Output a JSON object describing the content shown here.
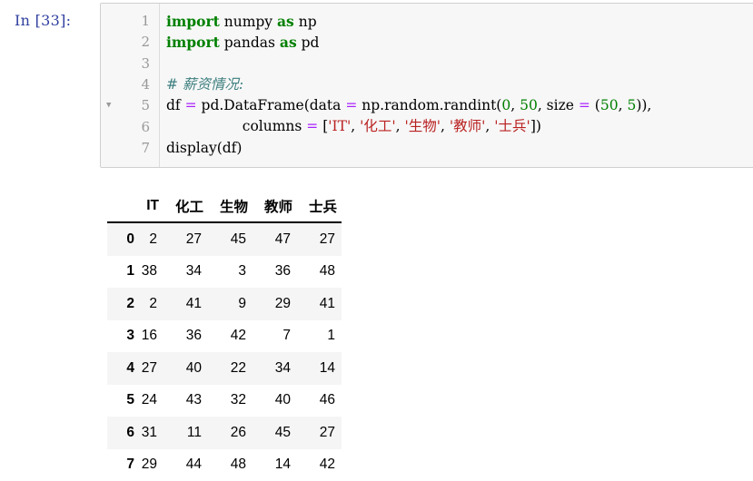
{
  "prompt": "In  [33]:",
  "code": {
    "line_numbers": [
      "1",
      "2",
      "3",
      "4",
      "5",
      "6",
      "7"
    ],
    "fold_marker_line": 5,
    "lines": [
      [
        {
          "t": "import",
          "c": "kw"
        },
        {
          "t": " numpy ",
          "c": ""
        },
        {
          "t": "as",
          "c": "kw"
        },
        {
          "t": " np",
          "c": ""
        }
      ],
      [
        {
          "t": "import",
          "c": "kw"
        },
        {
          "t": " pandas ",
          "c": ""
        },
        {
          "t": "as",
          "c": "kw"
        },
        {
          "t": " pd",
          "c": ""
        }
      ],
      [],
      [
        {
          "t": "# 薪资情况:",
          "c": "cm"
        }
      ],
      [
        {
          "t": "df ",
          "c": ""
        },
        {
          "t": "=",
          "c": "op"
        },
        {
          "t": " pd.DataFrame(data ",
          "c": ""
        },
        {
          "t": "=",
          "c": "op"
        },
        {
          "t": " np.random.randint(",
          "c": ""
        },
        {
          "t": "0",
          "c": "num"
        },
        {
          "t": ", ",
          "c": ""
        },
        {
          "t": "50",
          "c": "num"
        },
        {
          "t": ", size ",
          "c": ""
        },
        {
          "t": "=",
          "c": "op"
        },
        {
          "t": " (",
          "c": ""
        },
        {
          "t": "50",
          "c": "num"
        },
        {
          "t": ", ",
          "c": ""
        },
        {
          "t": "5",
          "c": "num"
        },
        {
          "t": ")),",
          "c": ""
        }
      ],
      [
        {
          "t": "                 columns ",
          "c": ""
        },
        {
          "t": "=",
          "c": "op"
        },
        {
          "t": " [",
          "c": ""
        },
        {
          "t": "'IT'",
          "c": "str"
        },
        {
          "t": ", ",
          "c": ""
        },
        {
          "t": "'化工'",
          "c": "str"
        },
        {
          "t": ", ",
          "c": ""
        },
        {
          "t": "'生物'",
          "c": "str"
        },
        {
          "t": ", ",
          "c": ""
        },
        {
          "t": "'教师'",
          "c": "str"
        },
        {
          "t": ", ",
          "c": ""
        },
        {
          "t": "'士兵'",
          "c": "str"
        },
        {
          "t": "])",
          "c": ""
        }
      ],
      [
        {
          "t": "display(df)",
          "c": ""
        }
      ]
    ]
  },
  "table": {
    "columns": [
      "",
      "IT",
      "化工",
      "生物",
      "教师",
      "士兵"
    ],
    "rows": [
      [
        "0",
        "2",
        "27",
        "45",
        "47",
        "27"
      ],
      [
        "1",
        "38",
        "34",
        "3",
        "36",
        "48"
      ],
      [
        "2",
        "2",
        "41",
        "9",
        "29",
        "41"
      ],
      [
        "3",
        "16",
        "36",
        "42",
        "7",
        "1"
      ],
      [
        "4",
        "27",
        "40",
        "22",
        "34",
        "14"
      ],
      [
        "5",
        "24",
        "43",
        "32",
        "40",
        "46"
      ],
      [
        "6",
        "31",
        "11",
        "26",
        "45",
        "27"
      ],
      [
        "7",
        "29",
        "44",
        "48",
        "14",
        "42"
      ]
    ]
  }
}
